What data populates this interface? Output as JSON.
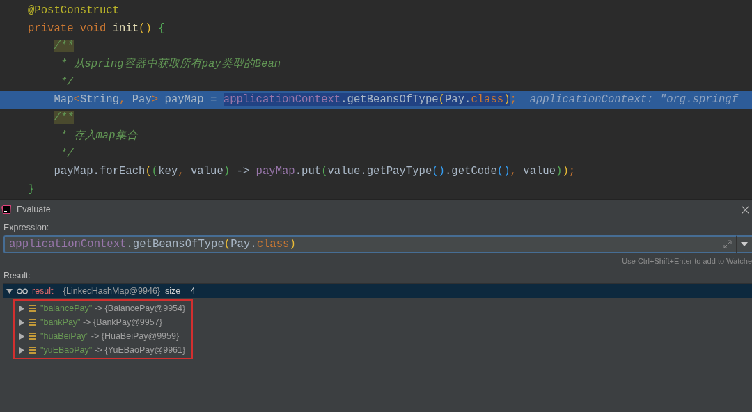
{
  "editor": {
    "lines": [
      {
        "selected": false,
        "tokens": [
          {
            "text": "@PostConstruct",
            "kind": "annotation"
          }
        ]
      },
      {
        "selected": false,
        "tokens": [
          {
            "text": "private void ",
            "kind": "keyword"
          },
          {
            "text": "init",
            "kind": "method"
          },
          {
            "text": "() ",
            "kind": "paren1"
          },
          {
            "text": "{",
            "kind": "paren2"
          }
        ]
      },
      {
        "selected": false,
        "tokens": [
          {
            "text": "    /**",
            "kind": "doc-marked"
          }
        ]
      },
      {
        "selected": false,
        "tokens": [
          {
            "text": "     * 从spring容器中获取所有pay类型的Bean",
            "kind": "doc"
          }
        ]
      },
      {
        "selected": false,
        "tokens": [
          {
            "text": "     */",
            "kind": "doc"
          }
        ]
      },
      {
        "selected": true,
        "tokens": [
          {
            "text": "    Map",
            "kind": "plain",
            "selected": false
          },
          {
            "text": "<",
            "kind": "keyword",
            "selected": false
          },
          {
            "text": "String",
            "kind": "plain",
            "selected": false
          },
          {
            "text": ", ",
            "kind": "keyword",
            "selected": false
          },
          {
            "text": "Pay",
            "kind": "plain",
            "selected": false
          },
          {
            "text": "> ",
            "kind": "keyword",
            "selected": false
          },
          {
            "text": "payMap = ",
            "kind": "plain",
            "selected": false
          },
          {
            "text": "applicationContext",
            "kind": "field",
            "selected": true
          },
          {
            "text": ".getBeansOfType",
            "kind": "plain",
            "selected": true
          },
          {
            "text": "(",
            "kind": "paren1",
            "selected": true
          },
          {
            "text": "Pay.",
            "kind": "plain",
            "selected": true
          },
          {
            "text": "class",
            "kind": "keyword",
            "selected": true
          },
          {
            "text": ")",
            "kind": "paren1",
            "selected": true
          },
          {
            "text": ";",
            "kind": "keyword",
            "selected": false
          },
          {
            "text": "  applicationContext: \"org.springf",
            "kind": "hint",
            "selected": false
          }
        ]
      },
      {
        "selected": false,
        "tokens": [
          {
            "text": "    /**",
            "kind": "doc-marked"
          }
        ]
      },
      {
        "selected": false,
        "tokens": [
          {
            "text": "     * 存入map集合",
            "kind": "doc"
          }
        ]
      },
      {
        "selected": false,
        "tokens": [
          {
            "text": "     */",
            "kind": "doc"
          }
        ]
      },
      {
        "selected": false,
        "tokens": [
          {
            "text": "    payMap.forEach",
            "kind": "plain"
          },
          {
            "text": "(",
            "kind": "paren1"
          },
          {
            "text": "(",
            "kind": "paren2"
          },
          {
            "text": "key",
            "kind": "plain"
          },
          {
            "text": ", ",
            "kind": "keyword"
          },
          {
            "text": "value",
            "kind": "plain"
          },
          {
            "text": ")",
            "kind": "paren2"
          },
          {
            "text": " -> ",
            "kind": "plain"
          },
          {
            "text": "payMap",
            "kind": "field-link"
          },
          {
            "text": ".put",
            "kind": "plain"
          },
          {
            "text": "(",
            "kind": "paren2"
          },
          {
            "text": "value.getPayType",
            "kind": "plain"
          },
          {
            "text": "()",
            "kind": "paren3"
          },
          {
            "text": ".getCode",
            "kind": "plain"
          },
          {
            "text": "()",
            "kind": "paren3"
          },
          {
            "text": ", ",
            "kind": "keyword"
          },
          {
            "text": "value",
            "kind": "plain"
          },
          {
            "text": ")",
            "kind": "paren2"
          },
          {
            "text": ")",
            "kind": "paren1"
          },
          {
            "text": ";",
            "kind": "keyword"
          }
        ]
      },
      {
        "selected": false,
        "tokens": [
          {
            "text": "}",
            "kind": "paren2"
          }
        ]
      }
    ]
  },
  "dialog": {
    "title": "Evaluate",
    "expression": {
      "label": "Expression:",
      "tokens": [
        {
          "text": "applicationContext",
          "kind": "field"
        },
        {
          "text": ".getBeansOfType",
          "kind": "plain"
        },
        {
          "text": "(",
          "kind": "paren1"
        },
        {
          "text": "Pay.",
          "kind": "plain"
        },
        {
          "text": "class",
          "kind": "keyword"
        },
        {
          "text": ")",
          "kind": "paren1"
        }
      ]
    },
    "hint": "Use Ctrl+Shift+Enter to add to Watche",
    "result_label": "Result:",
    "tree": [
      {
        "kind": "watch",
        "name": "result",
        "value": "= {LinkedHashMap@9946}",
        "extra": "size = 4",
        "expanded": true,
        "selected": true,
        "outlined": true,
        "children": [
          {
            "kind": "entry",
            "name": "\"balancePay\"",
            "value": "-> {BalancePay@9954}",
            "expanded": false,
            "selected": false
          },
          {
            "kind": "entry",
            "name": "\"bankPay\"",
            "value": "-> {BankPay@9957}",
            "expanded": false,
            "selected": false
          },
          {
            "kind": "entry",
            "name": "\"huaBeiPay\"",
            "value": "-> {HuaBeiPay@9959}",
            "expanded": false,
            "selected": false
          },
          {
            "kind": "entry",
            "name": "\"yuEBaoPay\"",
            "value": "-> {YuEBaoPay@9961}",
            "expanded": false,
            "selected": false
          }
        ]
      }
    ]
  }
}
